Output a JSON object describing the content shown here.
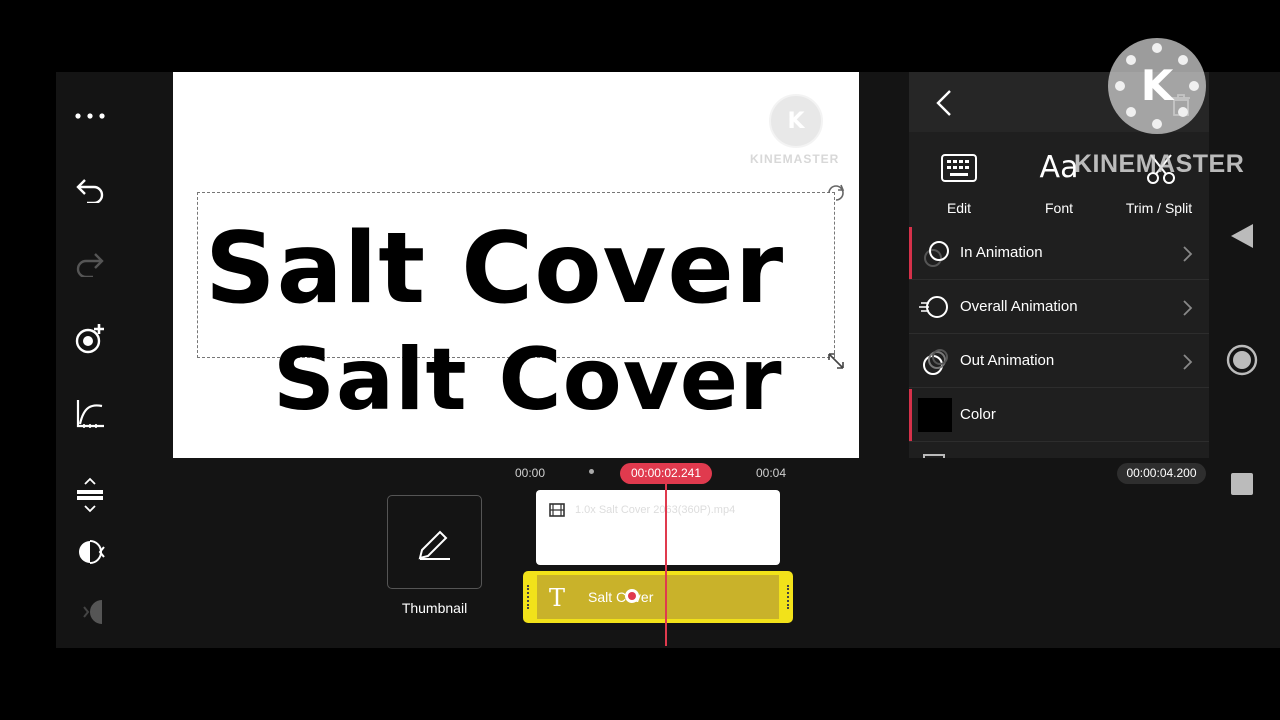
{
  "preview": {
    "title_line1": "Salt Cover",
    "title_line2": "Salt Cover",
    "watermark_text": "KINEMASTER"
  },
  "overlay_watermark": {
    "text": "KINEMASTER"
  },
  "toolbar": {
    "edit_label": "Edit",
    "font_label": "Font",
    "font_glyph": "Aa",
    "trim_label": "Trim / Split"
  },
  "menu": {
    "items": [
      {
        "label": "In Animation"
      },
      {
        "label": "Overall Animation"
      },
      {
        "label": "Out Animation"
      },
      {
        "label": "Color"
      }
    ]
  },
  "timeline": {
    "start_time": "00:00",
    "mark_time": "00:04",
    "playhead_time": "00:00:02.241",
    "total_duration": "00:00:04.200",
    "thumbnail_label": "Thumbnail",
    "video_clip_name": "1.0x Salt Cover 2063(360P).mp4",
    "text_clip_label": "Salt Cover"
  },
  "colors": {
    "accent_red": "#e03a4e",
    "text_clip_yellow": "#f2e21a",
    "color_swatch": "#000000"
  }
}
